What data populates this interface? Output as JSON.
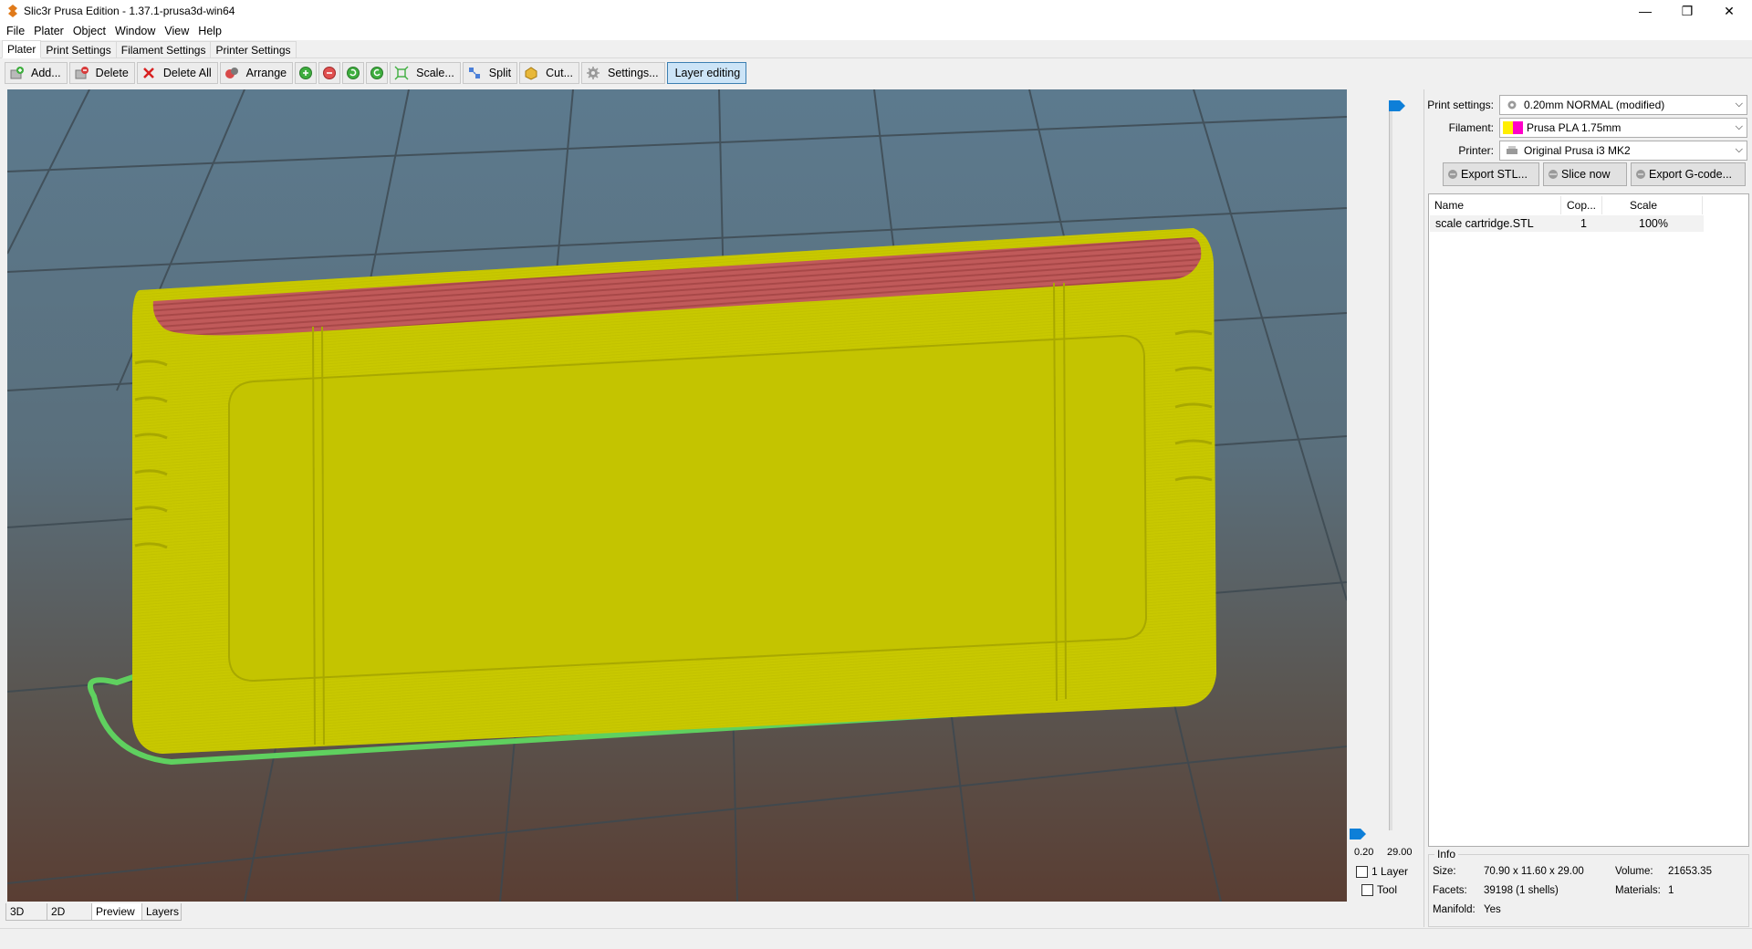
{
  "window": {
    "title": "Slic3r Prusa Edition - 1.37.1-prusa3d-win64",
    "controls": [
      "—",
      "❐",
      "✕"
    ]
  },
  "menu": [
    "File",
    "Plater",
    "Object",
    "Window",
    "View",
    "Help"
  ],
  "tabs": [
    "Plater",
    "Print Settings",
    "Filament Settings",
    "Printer Settings"
  ],
  "toolbar": {
    "add": "Add...",
    "delete": "Delete",
    "delete_all": "Delete All",
    "arrange": "Arrange",
    "scale": "Scale...",
    "split": "Split",
    "cut": "Cut...",
    "settings": "Settings...",
    "layer_editing": "Layer editing"
  },
  "slider": {
    "min": "0.20",
    "max": "29.00",
    "one_layer": "1 Layer",
    "tool": "Tool"
  },
  "view_tabs": [
    "3D",
    "2D",
    "Preview",
    "Layers"
  ],
  "settings": {
    "print_label": "Print settings:",
    "print_value": "0.20mm NORMAL (modified)",
    "filament_label": "Filament:",
    "filament_value": "Prusa PLA 1.75mm",
    "printer_label": "Printer:",
    "printer_value": "Original Prusa i3 MK2"
  },
  "export": {
    "stl": "Export STL...",
    "slice": "Slice now",
    "gcode": "Export G-code..."
  },
  "objects": {
    "columns": [
      "Name",
      "Cop...",
      "Scale"
    ],
    "rows": [
      {
        "name": "scale cartridge.STL",
        "copies": "1",
        "scale": "100%"
      }
    ]
  },
  "info": {
    "title": "Info",
    "size_label": "Size:",
    "size_value": "70.90 x 11.60 x 29.00",
    "volume_label": "Volume:",
    "volume_value": "21653.35",
    "facets_label": "Facets:",
    "facets_value": "39198 (1 shells)",
    "materials_label": "Materials:",
    "materials_value": "1",
    "manifold_label": "Manifold:",
    "manifold_value": "Yes"
  },
  "colors": {
    "model": "#c8c800",
    "top_layer": "#c05a5a",
    "skirt": "#5fd05f",
    "accent": "#0e7fd8",
    "filament_swatch_a": "#ffee00",
    "filament_swatch_b": "#ff00c8"
  }
}
